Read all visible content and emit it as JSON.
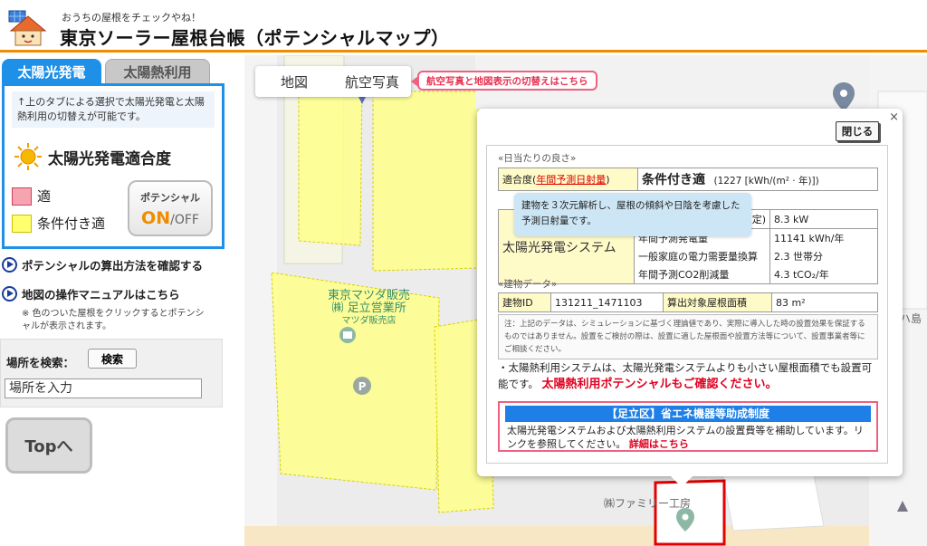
{
  "header": {
    "tagline": "おうちの屋根をチェックやね！",
    "title": "東京ソーラー屋根台帳（ポテンシャルマップ）"
  },
  "tabs": {
    "solar": "太陽光発電",
    "thermal": "太陽熱利用"
  },
  "panel": {
    "note": "↑上のタブによる選択で太陽光発電と太陽熱利用の切替えが可能です。",
    "suitability_title": "太陽光発電適合度",
    "legend_suitable": "適",
    "legend_conditional": "条件付き適",
    "potential_label": "ポテンシャル",
    "potential_on": "ON",
    "potential_off": "/OFF"
  },
  "links": {
    "calc_method": "ポテンシャルの算出方法を確認する",
    "manual": "地図の操作マニュアルはこちら",
    "note": "※ 色のついた屋根をクリックするとポテンシャルが表示されます。"
  },
  "search": {
    "label": "場所を検索：",
    "button": "検索",
    "placeholder": "場所を入力"
  },
  "top_button": "Topへ",
  "map": {
    "toggle_map": "地図",
    "toggle_aerial": "航空写真",
    "callout": "航空写真と地図表示の切替えはこちら",
    "poi_mazda": "東京マツダ販売",
    "poi_mazda_sub": "㈱ 足立営業所",
    "poi_mazda_sub2": "マツダ販売店",
    "poi_family": "㈱ファミリー工房",
    "edge_text": "ハ島"
  },
  "popup": {
    "x": "×",
    "close": "閉じる",
    "section_sun": "«日当たりの良さ»",
    "fit_label": "適合度(",
    "fit_link": "年間予測日射量",
    "fit_label_end": ")",
    "grade": "条件付き適",
    "irradiance": "(1227 [kWh/(m² · 年)])",
    "tooltip": "建物を３次元解析し、屋根の傾斜や日陰を考慮した予測日射量です。",
    "system_name": "太陽光発電システム",
    "capacity_label": "(推定)",
    "capacity_value": "8.3 kW",
    "annual_gen_label": "年間予測発電量",
    "annual_gen_value": "11141 kWh/年",
    "household_label": "一般家庭の電力需要量換算",
    "household_value": "2.3 世帯分",
    "co2_label": "年間予測CO2削減量",
    "co2_value": "4.3 tCO₂/年",
    "section_building": "«建物データ»",
    "building_id_label": "建物ID",
    "building_id": "131211_1471103",
    "area_label": "算出対象屋根面積",
    "area_value": "83 m²",
    "disclaimer": "注：上記のデータは、シミュレーションに基づく理論値であり、実際に導入した時の設置効果を保証するものではありません。設置をご検討の際は、設置に適した屋根面や設置方法等について、設置事業者等にご相談ください。",
    "thermal_note": "・太陽熱利用システムは、太陽光発電システムよりも小さい屋根面積でも設置可能です。",
    "thermal_cta": "太陽熱利用ポテンシャルもご確認ください。",
    "subsidy_title": "【足立区】省エネ機器等助成制度",
    "subsidy_desc": "太陽光発電システムおよび太陽熱利用システムの設置費等を補助しています。リンクを参照してください。",
    "detail_link": "詳細はこちら"
  }
}
